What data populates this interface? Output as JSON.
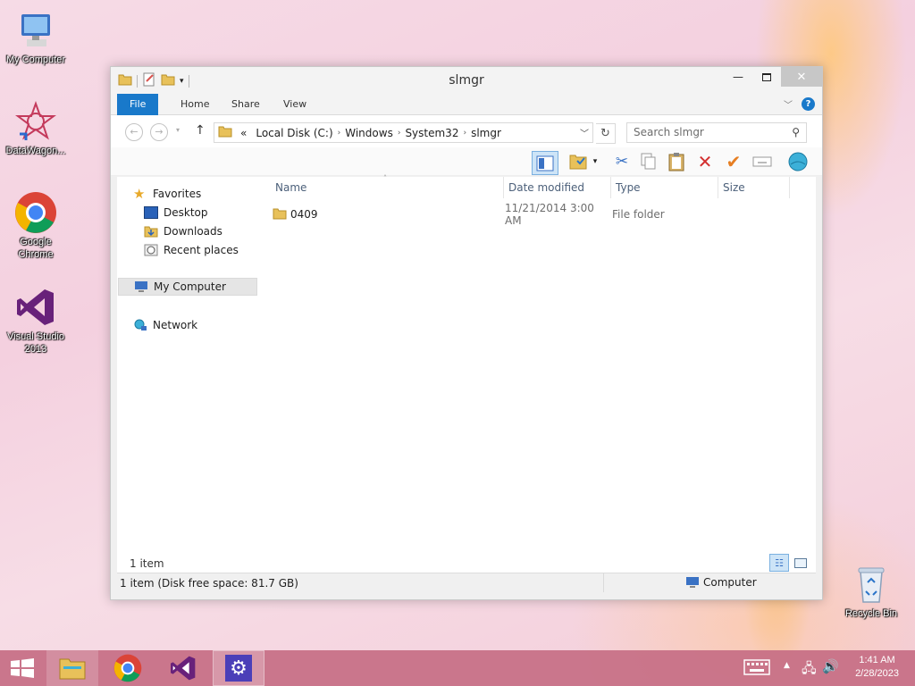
{
  "desktop": {
    "icons": [
      {
        "label": "My Computer"
      },
      {
        "label": "DataWagon..."
      },
      {
        "label": "Google Chrome"
      },
      {
        "label": "Visual Studio 2013"
      },
      {
        "label": "Recycle Bin"
      }
    ]
  },
  "window": {
    "title": "slmgr",
    "tabs": {
      "file": "File",
      "home": "Home",
      "share": "Share",
      "view": "View"
    },
    "help": "?",
    "address": {
      "prefix": "«",
      "crumbs": [
        "Local Disk (C:)",
        "Windows",
        "System32",
        "slmgr"
      ]
    },
    "search_placeholder": "Search slmgr",
    "nav": {
      "favorites": "Favorites",
      "desktop": "Desktop",
      "downloads": "Downloads",
      "recent": "Recent places",
      "computer": "My Computer",
      "network": "Network"
    },
    "columns": {
      "name": "Name",
      "date": "Date modified",
      "type": "Type",
      "size": "Size"
    },
    "files": [
      {
        "name": "0409",
        "date": "11/21/2014 3:00 AM",
        "type": "File folder",
        "size": ""
      }
    ],
    "item_count": "1 item",
    "status_left": "1 item (Disk free space: 81.7 GB)",
    "status_right": "Computer"
  },
  "taskbar": {
    "time": "1:41 AM",
    "date": "2/28/2023"
  },
  "colors": {
    "accent": "#1979ca",
    "taskbar": "#c66e84"
  }
}
